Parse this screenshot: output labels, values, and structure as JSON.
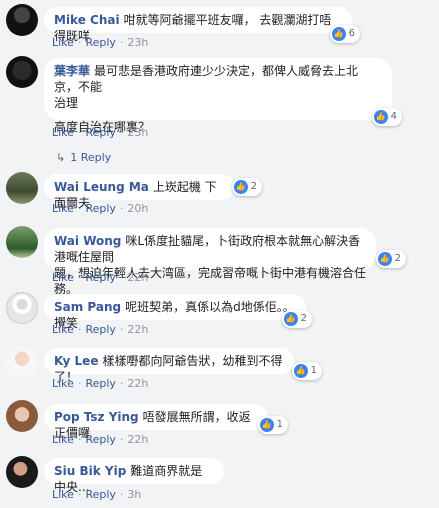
{
  "actions": {
    "like": "Like",
    "reply": "Reply",
    "sep": "·"
  },
  "comments": [
    {
      "author": "Mike Chai",
      "text": "咁就等阿爺擺平班友囉， 去觀瀾湖打唔得既咩",
      "reactions": "6",
      "time": "23h"
    },
    {
      "author": "葉李華",
      "text_lines": [
        "最可悲是香港政府連少少決定，都俾人威脅去上北京，不能",
        "治理",
        "",
        "高度自治在哪裏？"
      ],
      "reactions": "4",
      "time": "23h",
      "replies": "1 Reply"
    },
    {
      "author": "Wai Leung Ma",
      "text": "上崁起機 下面爾夫",
      "reactions": "2",
      "time": "20h"
    },
    {
      "author": "Wai Wong",
      "text_lines": [
        "咪L係度扯貓尾，卜街政府根本就無心解決香港嘅住屋問",
        "題，想迫年輕人去大湾區，完成習帝嘅卜街中港有機溶合任務。"
      ],
      "reactions": "2",
      "time": "22h"
    },
    {
      "author": "Sam Pang",
      "text": "呢班契弟，真係以為d地係佢。。攪笑",
      "reactions": "2",
      "time": "22h"
    },
    {
      "author": "Ky Lee",
      "text": "樣樣嘢都向阿爺告狀，幼稚到不得了！",
      "reactions": "1",
      "time": "22h"
    },
    {
      "author": "Pop Tsz Ying",
      "text": "唔發展無所謂，收返正價囉",
      "reactions": "1",
      "time": "22h"
    },
    {
      "author": "Siu Bik Yip",
      "text": "難道商界就是中央...",
      "time": "3h"
    }
  ]
}
